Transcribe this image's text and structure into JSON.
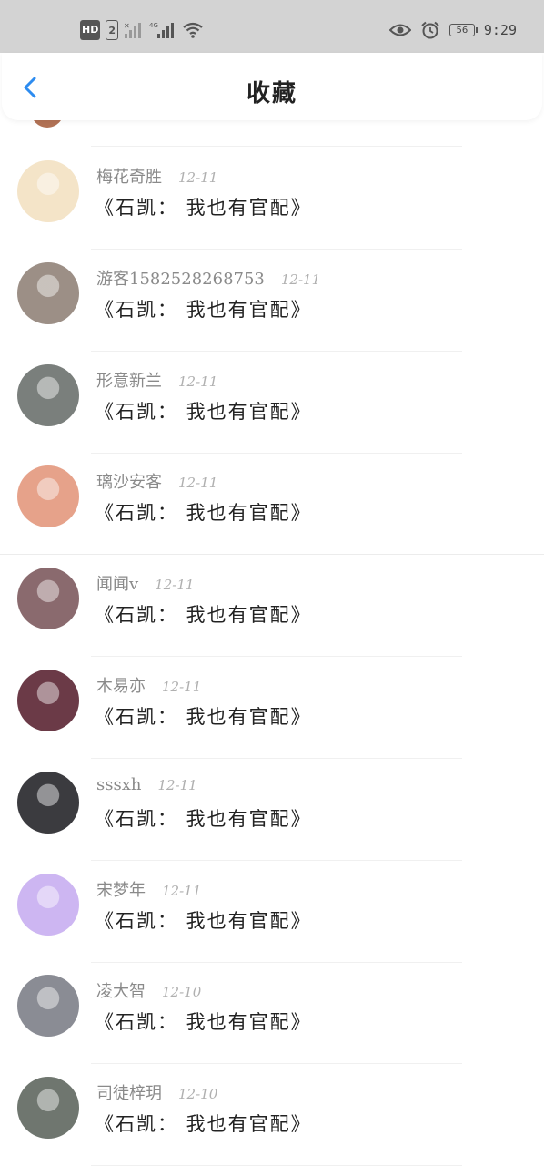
{
  "status_bar": {
    "hd": "HD",
    "sim": "2",
    "network": "4G",
    "battery": "56",
    "time": "9:29"
  },
  "header": {
    "title": "收藏"
  },
  "items": [
    {
      "username": "梅花奇胜",
      "date": "12-11",
      "content": "《石凯： 我也有官配》",
      "avatar_color": "#f4e4c8"
    },
    {
      "username": "游客1582528268753",
      "date": "12-11",
      "content": "《石凯： 我也有官配》",
      "avatar_color": "#9c8f86"
    },
    {
      "username": "形意新兰",
      "date": "12-11",
      "content": "《石凯： 我也有官配》",
      "avatar_color": "#7a7f7c"
    },
    {
      "username": "璃沙安客",
      "date": "12-11",
      "content": "《石凯： 我也有官配》",
      "avatar_color": "#e6a28a"
    },
    {
      "username": "闻闻v",
      "date": "12-11",
      "content": "《石凯： 我也有官配》",
      "avatar_color": "#8a6a6e"
    },
    {
      "username": "木易亦",
      "date": "12-11",
      "content": "《石凯： 我也有官配》",
      "avatar_color": "#6b3a47"
    },
    {
      "username": "sssxh",
      "date": "12-11",
      "content": "《石凯： 我也有官配》",
      "avatar_color": "#3b3b3f"
    },
    {
      "username": "宋梦年",
      "date": "12-11",
      "content": "《石凯： 我也有官配》",
      "avatar_color": "#cdb6f2"
    },
    {
      "username": "凌大智",
      "date": "12-10",
      "content": "《石凯： 我也有官配》",
      "avatar_color": "#8a8c94"
    },
    {
      "username": "司徒梓玥",
      "date": "12-10",
      "content": "《石凯： 我也有官配》",
      "avatar_color": "#6f766f"
    }
  ]
}
